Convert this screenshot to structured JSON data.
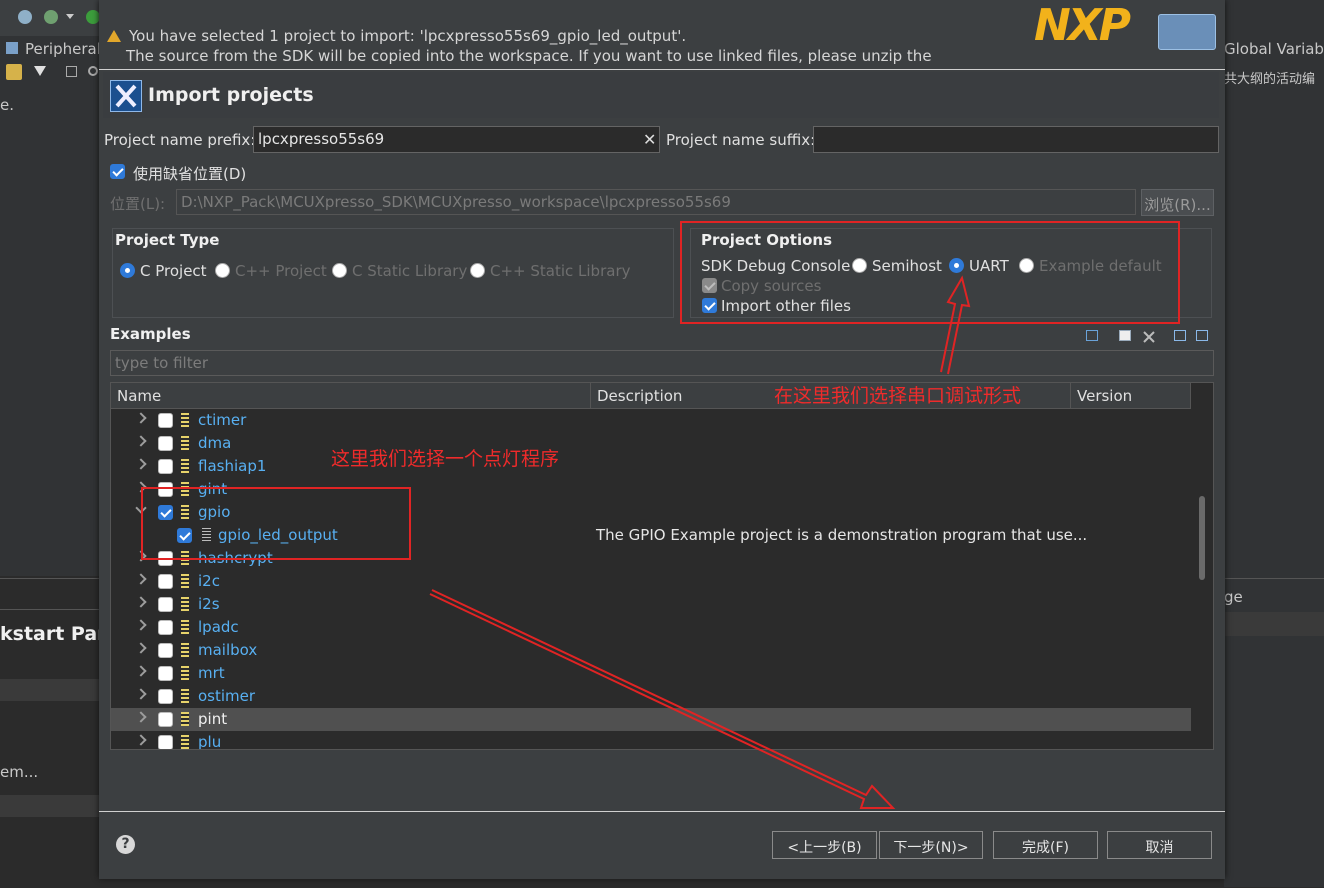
{
  "ide": {
    "tab_peripherals": "Peripheral",
    "tab_global_vars": "Global Variabl",
    "right_outline_text": "共大纲的活动编",
    "left_text_e": "e.",
    "quickstart": "kstart Pane",
    "left_item": "em...",
    "right_tab_fragment": "ge"
  },
  "banner": {
    "line1": "You have selected 1 project to import: 'lpcxpresso55s69_gpio_led_output'.",
    "line2": "The source from the SDK will be copied into the workspace. If you want to use linked files, please unzip the",
    "logo_text": "NXP"
  },
  "dialog": {
    "title": "Import projects",
    "prefix_label": "Project name prefix:",
    "prefix_value": "lpcxpresso55s69",
    "suffix_label": "Project name suffix:",
    "suffix_value": "",
    "default_location_label": "使用缺省位置(D)",
    "location_label": "位置(L):",
    "location_value": "D:\\NXP_Pack\\MCUXpresso_SDK\\MCUXpresso_workspace\\lpcxpresso55s69",
    "browse_label": "浏览(R)...",
    "project_type": {
      "title": "Project Type",
      "options": [
        "C Project",
        "C++ Project",
        "C Static Library",
        "C++ Static Library"
      ]
    },
    "project_options": {
      "title": "Project Options",
      "sdk_debug_label": "SDK Debug Console",
      "semihost": "Semihost",
      "uart": "UART",
      "example_default": "Example default",
      "copy_sources": "Copy sources",
      "import_other": "Import other files"
    },
    "examples_label": "Examples",
    "filter_placeholder": "type to filter",
    "columns": {
      "name": "Name",
      "description": "Description",
      "version": "Version"
    },
    "rows": [
      {
        "name": "ctimer"
      },
      {
        "name": "dma"
      },
      {
        "name": "flashiap1"
      },
      {
        "name": "gint"
      },
      {
        "name": "gpio"
      },
      {
        "name": "gpio_led_output",
        "desc": "The GPIO Example project is a demonstration program that use..."
      },
      {
        "name": "hashcrypt"
      },
      {
        "name": "i2c"
      },
      {
        "name": "i2s"
      },
      {
        "name": "lpadc"
      },
      {
        "name": "mailbox"
      },
      {
        "name": "mrt"
      },
      {
        "name": "ostimer"
      },
      {
        "name": "pint"
      },
      {
        "name": "plu"
      }
    ],
    "buttons": {
      "help": "?",
      "back": "<上一步(B)",
      "next": "下一步(N)>",
      "finish": "完成(F)",
      "cancel": "取消"
    }
  },
  "annotations": {
    "uart_note": "在这里我们选择串口调试形式",
    "gpio_note": "这里我们选择一个点灯程序"
  },
  "colors": {
    "annotation": "#e02424",
    "accent": "#2f7ad9",
    "tree_text": "#58b0f2"
  }
}
